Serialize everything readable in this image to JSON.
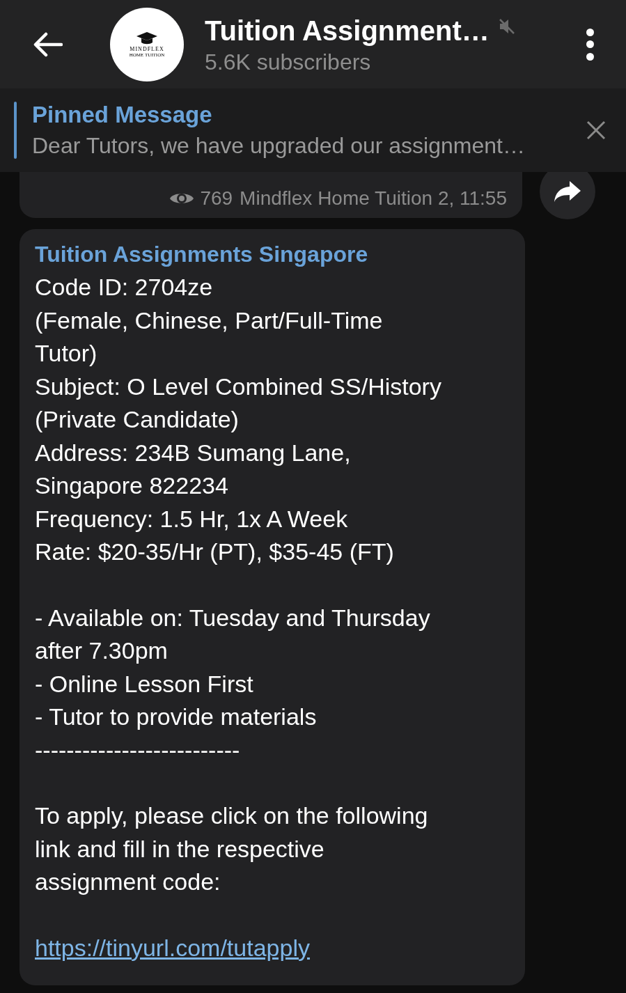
{
  "header": {
    "title": "Tuition Assignment…",
    "subtitle": "5.6K subscribers",
    "muted": true,
    "logo": {
      "name": "MINDFLEX",
      "tagline": "HOME TUITION"
    }
  },
  "pinned": {
    "label": "Pinned Message",
    "text": "Dear Tutors, we have upgraded our assignment…"
  },
  "messages": [
    {
      "kind": "tail",
      "views": "769",
      "signature": "Mindflex Home Tuition 2, 11:55"
    },
    {
      "kind": "post",
      "sender": "Tuition Assignments Singapore",
      "paragraphs": [
        [
          "Code ID: 2704ze",
          "(Female, Chinese, Part/Full-Time",
          "Tutor)",
          "Subject: O Level Combined SS/History",
          "(Private Candidate)",
          "Address: 234B Sumang Lane,",
          "Singapore 822234",
          "Frequency: 1.5 Hr, 1x A Week",
          "Rate: $20-35/Hr (PT), $35-45 (FT)"
        ],
        [
          "- Available on: Tuesday and Thursday",
          "after 7.30pm",
          "- Online Lesson First",
          "- Tutor to provide materials",
          "--------------------------"
        ],
        [
          "To apply, please click on the following",
          "link and fill in the respective",
          "assignment code:"
        ]
      ],
      "link": "https://tinyurl.com/tutapply"
    }
  ]
}
